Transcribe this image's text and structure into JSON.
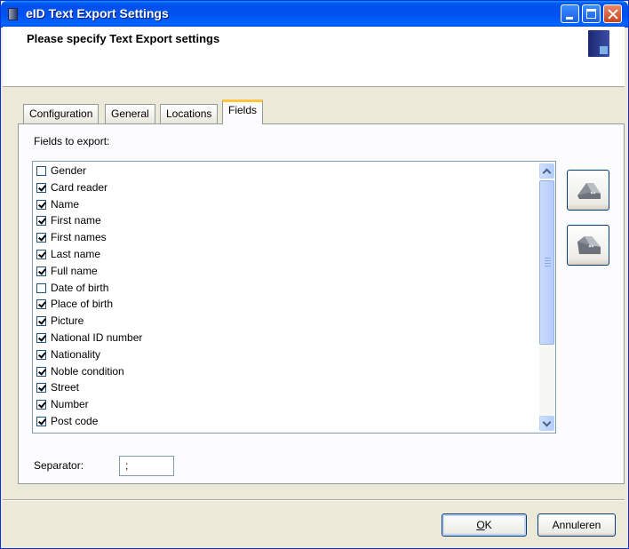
{
  "window": {
    "title": "eID Text Export Settings",
    "header_text": "Please specify Text Export settings"
  },
  "tabs": [
    {
      "label": "Configuration",
      "active": false
    },
    {
      "label": "General",
      "active": false
    },
    {
      "label": "Locations",
      "active": false
    },
    {
      "label": "Fields",
      "active": true
    }
  ],
  "fields_panel": {
    "label": "Fields to export:",
    "items": [
      {
        "label": "Gender",
        "checked": false
      },
      {
        "label": "Card reader",
        "checked": true
      },
      {
        "label": "Name",
        "checked": true
      },
      {
        "label": "First name",
        "checked": true
      },
      {
        "label": "First names",
        "checked": true
      },
      {
        "label": "Last name",
        "checked": true
      },
      {
        "label": "Full name",
        "checked": true
      },
      {
        "label": "Date of birth",
        "checked": false
      },
      {
        "label": "Place of birth",
        "checked": true
      },
      {
        "label": "Picture",
        "checked": true
      },
      {
        "label": "National ID number",
        "checked": true
      },
      {
        "label": "Nationality",
        "checked": true
      },
      {
        "label": "Noble condition",
        "checked": true
      },
      {
        "label": "Street",
        "checked": true
      },
      {
        "label": "Number",
        "checked": true
      },
      {
        "label": "Post code",
        "checked": true
      }
    ]
  },
  "separator": {
    "label": "Separator:",
    "value": ";"
  },
  "buttons": {
    "ok_prefix": "O",
    "ok_rest": "K",
    "cancel": "Annuleren"
  },
  "icons": {
    "app": "eid-app-icon",
    "move_up": "move-up-icon",
    "move_down": "move-down-icon"
  },
  "colors": {
    "titlebar": "#0053ee",
    "active_tab_accent": "#ffc73c",
    "dialog_bg": "#ece9d8"
  }
}
